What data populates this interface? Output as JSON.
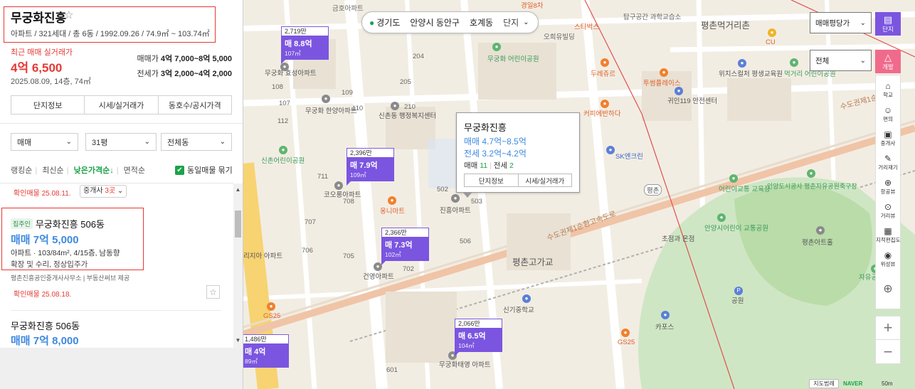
{
  "complex": {
    "name": "무궁화진흥",
    "summary": "아파트 / 321세대 / 총 6동 / 1992.09.26 / 74.9㎡ ~ 103.74㎡",
    "recent_label": "최근 매매 실거래가",
    "recent_price": "4억 6,500",
    "recent_date": "2025.08.09, 14층, 74㎡",
    "sale_range_label": "매매가",
    "sale_range": "4억 7,000~8억 5,000",
    "jeonse_range_label": "전세가",
    "jeonse_range": "3억 2,000~4억 2,000",
    "tabs": [
      "단지정보",
      "시세/실거래가",
      "동호수/공시가격"
    ]
  },
  "filters": {
    "trade": "매매",
    "size": "31평",
    "dong": "전체동"
  },
  "sort": {
    "items": [
      "랭킹순",
      "최신순",
      "낮은가격순↓",
      "면적순"
    ],
    "checkbox_label": "동일매물 묶기"
  },
  "listings": {
    "l0": {
      "confirm": "확인매물 25.08.11.",
      "agent_prefix": "중개사 ",
      "agent_count": "3곳",
      "agent_suffix": " ⌄"
    },
    "l1": {
      "tag": "집주인",
      "name": "무궁화진흥 506동",
      "price": "매매 7억 5,000",
      "spec": "아파트 · 103/84m², 4/15층, 남동향",
      "desc": "확장 및 수리, 정상입주가",
      "source": "평촌진흥공인중개사사무소  |  부동산써브 제공",
      "confirm": "확인매물 25.08.18."
    },
    "l2": {
      "name": "무궁화진흥 506동",
      "price": "매매 7억 8,000"
    }
  },
  "location": {
    "province": "경기도",
    "city": "안양시 동안구",
    "dong": "호계동",
    "mode": "단지"
  },
  "map_selectors": {
    "price_unit": "매매평당가",
    "filter": "전체"
  },
  "toolbar": {
    "danji": "단지",
    "gaebal": "개발",
    "items": [
      "학교",
      "편의",
      "중개사",
      "거리재기",
      "항공뷰",
      "거리뷰",
      "지적편집도",
      "위성뷰"
    ]
  },
  "markers": [
    {
      "top": "2,719만",
      "price": "매 8.8억",
      "area": "107㎡"
    },
    {
      "top": "2,396만",
      "price": "매 7.9억",
      "area": "109㎡"
    },
    {
      "top": "2,366만",
      "price": "매 7.3억",
      "area": "102㎡"
    },
    {
      "top": "2,066만",
      "price": "매 6.5억",
      "area": "104㎡"
    },
    {
      "top": "1,486만",
      "price": "매 4억",
      "area": "89㎡"
    }
  ],
  "popup": {
    "name": "무궁화진흥",
    "sale": "매매 4.7억~8.5억",
    "jeonse": "전세 3.2억~4.2억",
    "sale_count_label": "매매 ",
    "sale_count": "11",
    "jeonse_count_label": "전세 ",
    "jeonse_count": "2",
    "btn1": "단지정보",
    "btn2": "시세/실거래가"
  },
  "map_labels": {
    "geumhwa": "금호아파트",
    "gyeongil": "경일8차",
    "starbucks": "스타벅스",
    "tapgong": "탑구공간 과학교습소",
    "pyeongchon_st": "평촌먹거리촌",
    "cu": "CU",
    "ohuiu": "오희유빌딩",
    "mugung_park": "무궁화 어린이공원",
    "mugung_hyo": "무궁화 효성아파트",
    "mugung_hanyang": "무궁화 한양아파트",
    "sinchon_welfare": "신촌동 행정복지센터",
    "duregae": "두레쥬르",
    "coffee": "커피에반하다",
    "toon": "투썸플레이스",
    "wichi": "위치스컬처 평생교육원",
    "meokgeori_park": "먹거리 어린이공원",
    "gwin": "귀인119 안전센터",
    "sinchon_park": "신촌어린이공원",
    "koryong": "코오롱아파트",
    "onmart": "옹니마트",
    "jinheung": "진흥아파트",
    "sk": "SK엔크린",
    "pyeongchon": "평촌",
    "kids_traffic": "어린이교통 교육장",
    "anyang_corp": "안양도시공사 평촌자유공원축구장",
    "choijeom": "초점과 온점",
    "anyang_kids": "안양시어린이 교통공원",
    "pyeongchon_gyo": "평촌고가교",
    "pyeongchon_ahreum": "평촌아트홀",
    "gunyoung": "건영아파트",
    "jayu_park": "자유공원",
    "sinkee": "신기중학교",
    "kaos": "카포스",
    "gs25a": "GS25",
    "gs25b": "GS25",
    "mugung_taeyoung": "무궁화태영 아파트",
    "sudogwon": "수도권제1순환고속도로",
    "sudogwon2": "수도권제1순",
    "gongwon": "공원",
    "maeul": "리지아 아파트",
    "n711": "711",
    "n708": "708",
    "n707": "707",
    "n706": "706",
    "n705": "705",
    "n702": "702",
    "n502": "502",
    "n503": "503",
    "n506": "506",
    "n205": "205",
    "n204": "204",
    "n210": "210",
    "n112": "112",
    "n110": "110",
    "n109": "109",
    "n108": "108",
    "n107": "107",
    "n601": "601"
  },
  "map_footer": {
    "view_btn": "지도범례",
    "brand": "NAVER",
    "scale": "50m"
  }
}
